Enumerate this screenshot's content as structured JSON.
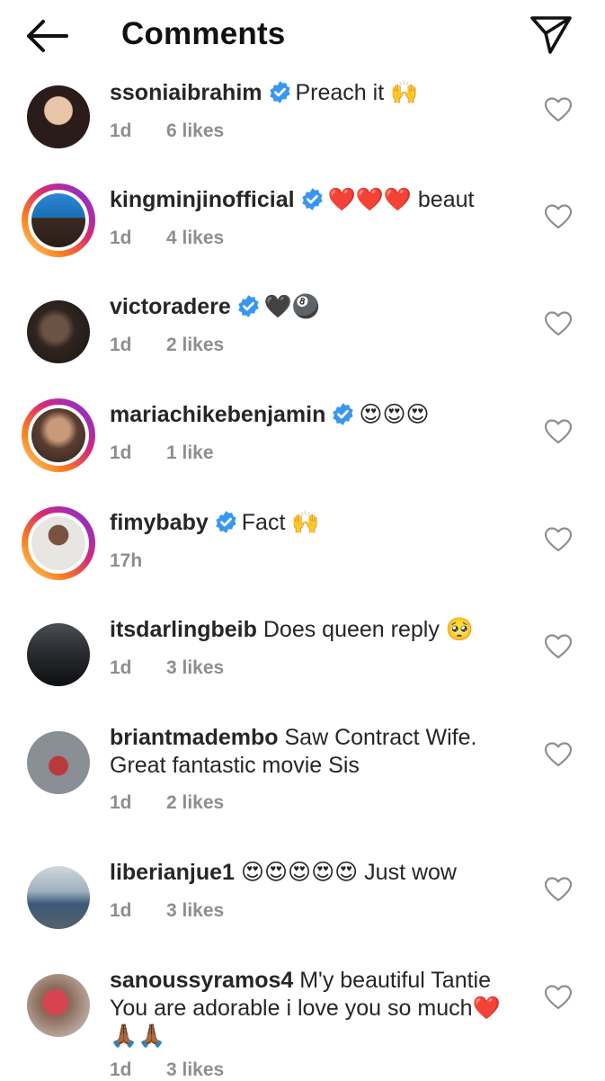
{
  "header": {
    "title": "Comments"
  },
  "comments": [
    {
      "username": "ssoniaibrahim",
      "verified": true,
      "text": "Preach it 🙌",
      "time": "1d",
      "likes": "6 likes",
      "story": false,
      "avatar_color": "#3a2a2a"
    },
    {
      "username": "kingminjinofficial",
      "verified": true,
      "text": "❤️❤️❤️ beaut",
      "time": "1d",
      "likes": "4 likes",
      "story": true,
      "avatar_color": "#1b6fb3"
    },
    {
      "username": "victoradere",
      "verified": true,
      "text": "🖤🎱",
      "time": "1d",
      "likes": "2 likes",
      "story": false,
      "avatar_color": "#4a3a2e"
    },
    {
      "username": "mariachikebenjamin",
      "verified": true,
      "text": "😍😍😍",
      "time": "1d",
      "likes": "1 like",
      "story": true,
      "avatar_color": "#7a5a48"
    },
    {
      "username": "fimybaby",
      "verified": true,
      "text": "Fact 🙌",
      "time": "17h",
      "likes": "",
      "story": true,
      "avatar_color": "#6e4a38"
    },
    {
      "username": "itsdarlingbeib",
      "verified": false,
      "text": "Does queen reply 🥺",
      "time": "1d",
      "likes": "3 likes",
      "story": false,
      "avatar_color": "#1e1e22"
    },
    {
      "username": "briantmadembo",
      "verified": false,
      "text": "Saw Contract Wife. Great fantastic movie Sis",
      "time": "1d",
      "likes": "2 likes",
      "story": false,
      "avatar_color": "#8a8f96"
    },
    {
      "username": "liberianjue1",
      "verified": false,
      "text": "😍😍😍😍😍 Just wow",
      "time": "1d",
      "likes": "3 likes",
      "story": false,
      "avatar_color": "#5f7384"
    },
    {
      "username": "sanoussyramos4",
      "verified": false,
      "text": "M'y beautiful Tantie You are adorable i love you so much❤️🙏🏾🙏🏾",
      "time": "1d",
      "likes": "3 likes",
      "story": false,
      "avatar_color": "#c2394a"
    }
  ],
  "icons": {
    "back": "arrow-left-icon",
    "send": "paper-plane-icon",
    "like": "heart-outline-icon",
    "verified": "verified-badge-icon"
  },
  "colors": {
    "verified": "#3897f0",
    "meta": "#8e8e8e",
    "text": "#262626"
  }
}
